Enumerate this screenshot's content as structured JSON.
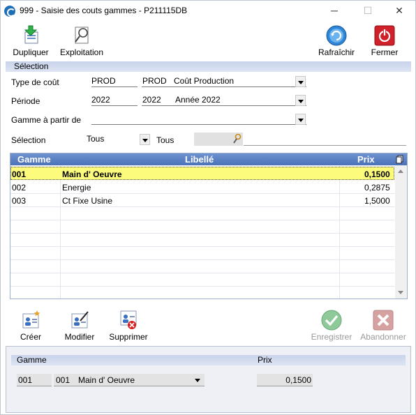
{
  "window": {
    "title": "999 - Saisie des couts gammes - P211115DB",
    "minimize": "─",
    "maximize": "☐",
    "close": "✕"
  },
  "toolbar": {
    "dupliquer": "Dupliquer",
    "exploitation": "Exploitation",
    "rafraichir": "Rafraîchir",
    "fermer": "Fermer"
  },
  "selection": {
    "header": "Sélection",
    "type_label": "Type de coût",
    "type_code": "PROD",
    "type_code2": "PROD",
    "type_desc": "Coût Production",
    "periode_label": "Période",
    "periode_code": "2022",
    "periode_code2": "2022",
    "periode_desc": "Année 2022",
    "gamme_label": "Gamme à partir de",
    "gamme_value": "",
    "sel_label": "Sélection",
    "sel_value": "Tous",
    "sel_text": "Tous"
  },
  "grid": {
    "columns": {
      "gamme": "Gamme",
      "libelle": "Libellé",
      "prix": "Prix"
    },
    "rows": [
      {
        "gamme": "001",
        "libelle": "Main d' Oeuvre",
        "prix": "0,1500"
      },
      {
        "gamme": "002",
        "libelle": "Energie",
        "prix": "0,2875"
      },
      {
        "gamme": "003",
        "libelle": "Ct Fixe Usine",
        "prix": "1,5000"
      }
    ]
  },
  "actions": {
    "creer": "Créer",
    "modifier": "Modifier",
    "supprimer": "Supprimer",
    "enregistrer": "Enregistrer",
    "abandonner": "Abandonner"
  },
  "detail": {
    "gamme_header": "Gamme",
    "prix_header": "Prix",
    "gamme_code": "001",
    "gamme_code2": "001",
    "gamme_desc": "Main d' Oeuvre",
    "prix_value": "0,1500"
  },
  "colors": {
    "grid_header": "#5a7fc2",
    "selected_row": "#fdfb7c",
    "section_bar": "#d2dbef"
  }
}
